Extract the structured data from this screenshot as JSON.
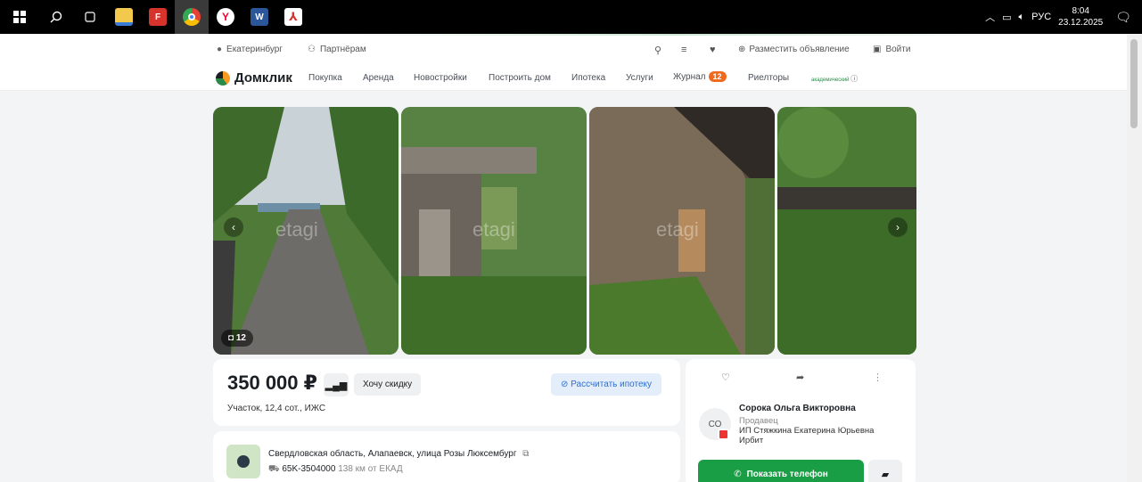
{
  "taskbar": {
    "lang": "РУС",
    "time": "8:04",
    "date": "23.12.2025",
    "apps": [
      "windows-start-icon",
      "search-icon",
      "task-view-icon",
      "file-explorer-icon",
      "foxit-icon",
      "chrome-icon",
      "yandex-browser-icon",
      "word-icon",
      "pdf-reader-icon"
    ]
  },
  "topbar": {
    "city": "Екатеринбург",
    "partners": "Партнёрам",
    "post_ad": "Разместить объявление",
    "login": "Войти"
  },
  "nav": {
    "brand": "Домклик",
    "items": [
      "Покупка",
      "Аренда",
      "Новостройки",
      "Построить дом",
      "Ипотека",
      "Услуги"
    ],
    "journal": "Журнал",
    "journal_count": "12",
    "realtors": "Риелторы",
    "promo": "академический"
  },
  "gallery": {
    "watermark": "etagi",
    "photo_count": "12"
  },
  "listing": {
    "price": "350 000 ₽",
    "discount_btn": "Хочу скидку",
    "mortgage_btn": "Рассчитать ипотеку",
    "subtitle": "Участок, 12,4 сот., ИЖС",
    "address": "Свердловская область, Алапаевск, улица Розы Люксембург",
    "road": "65K-3504000",
    "distance": "138 км от ЕКАД"
  },
  "seller": {
    "initials": "СО",
    "name": "Сорока Ольга Викторовна",
    "role": "Продавец",
    "company": "ИП Стяжкина Екатерина Юрьевна Ирбит",
    "phone_btn": "Показать телефон"
  },
  "colors": {
    "accent_green": "#1a9e45",
    "badge_orange": "#f06a1d",
    "link_blue": "#2d6fd1"
  }
}
